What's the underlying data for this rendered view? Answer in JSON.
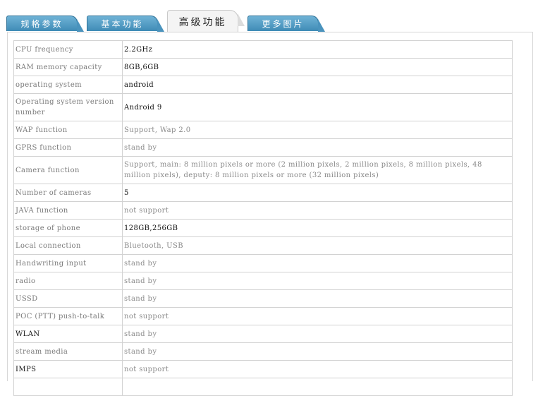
{
  "tabs": [
    {
      "label": "规格参数"
    },
    {
      "label": "基本功能"
    },
    {
      "label": "高级功能"
    },
    {
      "label": "更多图片"
    }
  ],
  "specs": [
    {
      "key": "CPU frequency",
      "value": "2.2GHz"
    },
    {
      "key": "RAM memory capacity",
      "value": "8GB,6GB"
    },
    {
      "key": "operating system",
      "value": "android"
    },
    {
      "key": "Operating system version number",
      "value": "Android 9"
    },
    {
      "key": "WAP function",
      "value": "Support, Wap 2.0"
    },
    {
      "key": "GPRS function",
      "value": "stand by"
    },
    {
      "key": "Camera function",
      "value": "Support, main: 8 million pixels or more (2 million pixels, 2 million pixels, 8 million pixels, 48 million pixels), deputy: 8 million pixels or more (32 million pixels)"
    },
    {
      "key": "Number of cameras",
      "value": "5"
    },
    {
      "key": "JAVA function",
      "value": "not support"
    },
    {
      "key": "storage of phone",
      "value": "128GB,256GB"
    },
    {
      "key": "Local connection",
      "value": "Bluetooth, USB"
    },
    {
      "key": "Handwriting input",
      "value": "stand by"
    },
    {
      "key": "radio",
      "value": "stand by"
    },
    {
      "key": "USSD",
      "value": "stand by"
    },
    {
      "key": "POC (PTT) push-to-talk",
      "value": "not support"
    },
    {
      "key": "WLAN",
      "value": "stand by"
    },
    {
      "key": "stream media",
      "value": "stand by"
    },
    {
      "key": "IMPS",
      "value": "not support"
    },
    {
      "key": "",
      "value": ""
    }
  ]
}
